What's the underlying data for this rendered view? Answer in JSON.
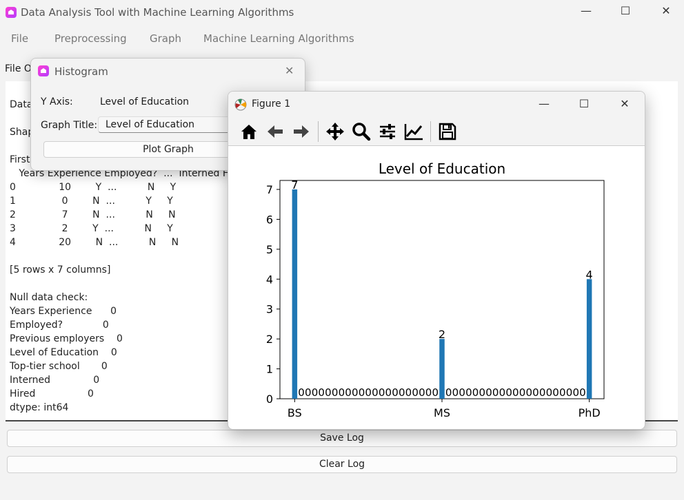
{
  "app": {
    "title": "Data Analysis Tool with Machine Learning Algorithms",
    "controls": {
      "minimize": "—",
      "maximize": "☐",
      "close": "✕"
    }
  },
  "menu": [
    "File",
    "Preprocessing",
    "Graph",
    "Machine Learning Algorithms"
  ],
  "section_label": "File O",
  "log_lines": [
    "Data",
    "",
    "Shap",
    "",
    "First",
    "   Years Experience Employed?  ...  Interned Hired",
    "0              10        Y  ...          N     Y",
    "1               0        N  ...          Y     Y",
    "2               7        N  ...          N     N",
    "3               2        Y  ...          N     Y",
    "4              20        N  ...          N     N",
    "",
    "[5 rows x 7 columns]",
    "",
    "Null data check:",
    "Years Experience      0",
    "Employed?             0",
    "Previous employers    0",
    "Level of Education    0",
    "Top-tier school       0",
    "Interned              0",
    "Hired                 0",
    "dtype: int64"
  ],
  "buttons": {
    "save_log": "Save Log",
    "clear_log": "Clear Log"
  },
  "histogram_dialog": {
    "title": "Histogram",
    "close": "✕",
    "y_axis_label": "Y Axis:",
    "y_axis_value": "Level of Education",
    "graph_title_label": "Graph Title:",
    "graph_title_value": "Level of Education",
    "plot_button": "Plot Graph"
  },
  "figure_window": {
    "title": "Figure 1",
    "controls": {
      "minimize": "—",
      "maximize": "☐",
      "close": "✕"
    },
    "toolbar": [
      "home-icon",
      "back-arrow-icon",
      "forward-arrow-icon",
      "pan-move-icon",
      "zoom-magnifier-icon",
      "configure-subplots-icon",
      "edit-axis-icon",
      "save-figure-icon"
    ]
  },
  "chart_data": {
    "type": "bar",
    "title": "Level of Education",
    "xlabel": "",
    "ylabel": "",
    "categories": [
      "BS",
      "MS",
      "PhD"
    ],
    "x_positions": [
      0,
      1,
      2
    ],
    "values": [
      7,
      2,
      4
    ],
    "bar_labels": [
      "7",
      "2",
      "4"
    ],
    "zero_label_count_between": 21,
    "ylim": [
      0,
      7.3
    ],
    "yticks": [
      0,
      1,
      2,
      3,
      4,
      5,
      6,
      7
    ],
    "bar_color": "#1f77b4",
    "grid": false
  }
}
